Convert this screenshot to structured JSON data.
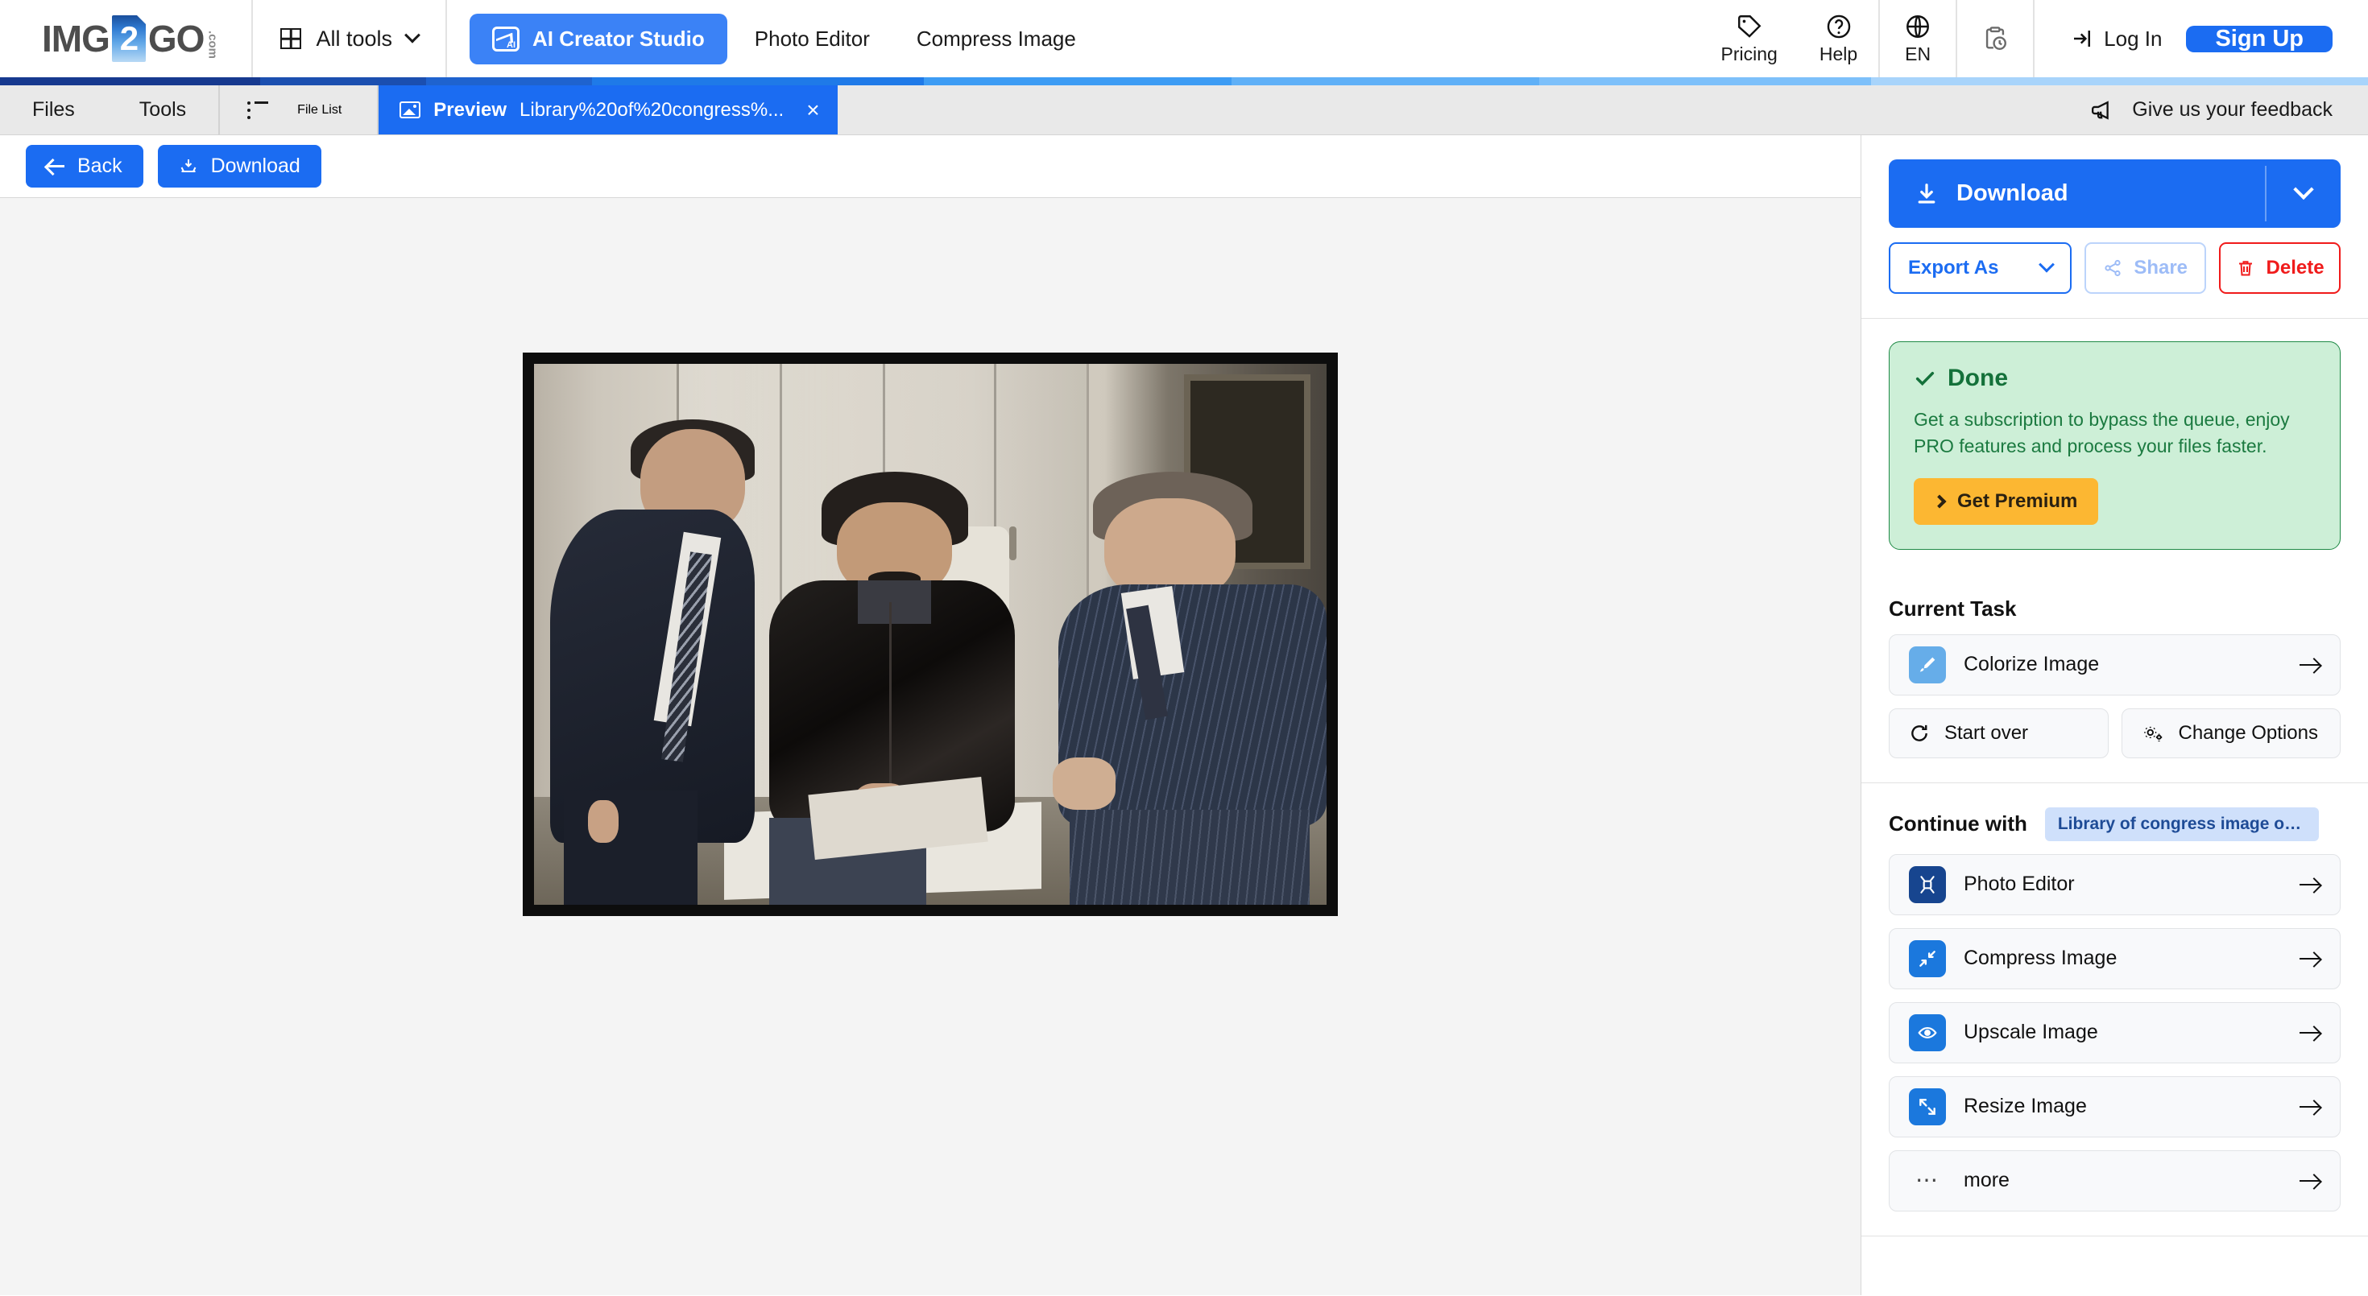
{
  "header": {
    "logo": {
      "pre": "IMG",
      "mid": "2",
      "post": "GO",
      "suffix": ".com"
    },
    "all_tools": "All tools",
    "ai_creator_studio": "AI Creator Studio",
    "nav_links": [
      "Photo Editor",
      "Compress Image"
    ],
    "pricing": "Pricing",
    "help": "Help",
    "language": "EN",
    "log_in": "Log In",
    "sign_up": "Sign Up",
    "accent_blue": "#1b6cf2"
  },
  "gradient_bar": {
    "segments": [
      "#16398f",
      "#1b4fb0",
      "#1f63cf",
      "#1f7ae8",
      "#3d9cf4",
      "#5fb0f7",
      "#7dc0fa",
      "#a8d4fb"
    ]
  },
  "tabbar": {
    "files": "Files",
    "tools": "Tools",
    "file_list": "File List",
    "preview_label": "Preview",
    "preview_filename": "Library%20of%20congress%...",
    "close": "×",
    "feedback": "Give us your feedback"
  },
  "toolrow": {
    "back": "Back",
    "download": "Download"
  },
  "preview": {
    "alt": "Colorized photograph of three men examining a document"
  },
  "sidebar": {
    "download_label": "Download",
    "export_as": "Export As",
    "share": "Share",
    "delete": "Delete",
    "done": {
      "title": "Done",
      "text": "Get a subscription to bypass the queue, enjoy PRO features and process your files faster.",
      "cta": "Get Premium",
      "bg": "#cdefd7",
      "border": "#1f8a46",
      "cta_bg": "#fcb732"
    },
    "current_task": {
      "heading": "Current Task",
      "task_label": "Colorize Image",
      "start_over": "Start over",
      "change_options": "Change Options"
    },
    "continue_with": {
      "heading": "Continue with",
      "file_badge": "Library of congress image of t...",
      "items": [
        {
          "label": "Photo Editor",
          "icon": "photo-editor-icon",
          "color": "#17458f"
        },
        {
          "label": "Compress Image",
          "icon": "compress-icon",
          "color": "#1b78dd"
        },
        {
          "label": "Upscale Image",
          "icon": "upscale-eye-icon",
          "color": "#1b78dd"
        },
        {
          "label": "Resize Image",
          "icon": "resize-icon",
          "color": "#1b78dd"
        },
        {
          "label": "more",
          "icon": "ellipsis-icon",
          "color": "transparent"
        }
      ]
    }
  }
}
